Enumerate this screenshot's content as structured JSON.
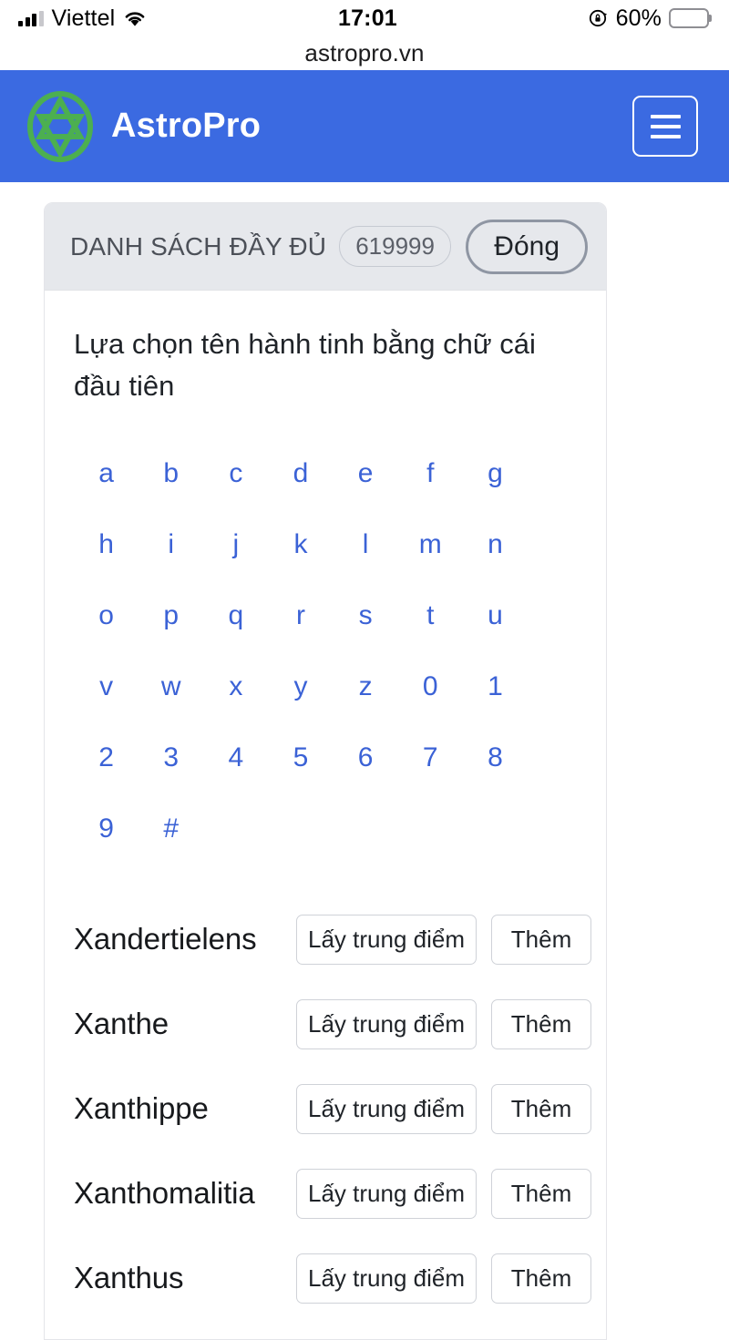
{
  "status_bar": {
    "carrier": "Viettel",
    "time": "17:01",
    "battery_percent": "60%",
    "signal_icon": "signal-bars-icon",
    "wifi_icon": "wifi-icon",
    "rotation_lock_icon": "rotation-lock-icon",
    "battery_icon": "battery-icon",
    "battery_level": 60
  },
  "browser": {
    "url": "astropro.vn"
  },
  "app_header": {
    "brand_title": "AstroPro",
    "logo_icon": "hexagram-circle-logo",
    "menu_icon": "hamburger-menu-icon",
    "background_color": "#3b6ae1",
    "logo_color": "#4caf50"
  },
  "panel": {
    "header_title": "DANH SÁCH ĐẦY ĐỦ",
    "count_badge": "619999",
    "close_label": "Đóng",
    "prompt": "Lựa chọn tên hành tinh bằng chữ cái đầu tiên",
    "link_color": "#3b62d6"
  },
  "alphabet": [
    "a",
    "b",
    "c",
    "d",
    "e",
    "f",
    "g",
    "h",
    "i",
    "j",
    "k",
    "l",
    "m",
    "n",
    "o",
    "p",
    "q",
    "r",
    "s",
    "t",
    "u",
    "v",
    "w",
    "x",
    "y",
    "z",
    "0",
    "1",
    "2",
    "3",
    "4",
    "5",
    "6",
    "7",
    "8",
    "9",
    "#"
  ],
  "row_actions": {
    "midpoint_label": "Lấy trung điểm",
    "add_label": "Thêm"
  },
  "planets": [
    {
      "name": "Xandertielens"
    },
    {
      "name": "Xanthe"
    },
    {
      "name": "Xanthippe"
    },
    {
      "name": "Xanthomalitia"
    },
    {
      "name": "Xanthus"
    }
  ]
}
